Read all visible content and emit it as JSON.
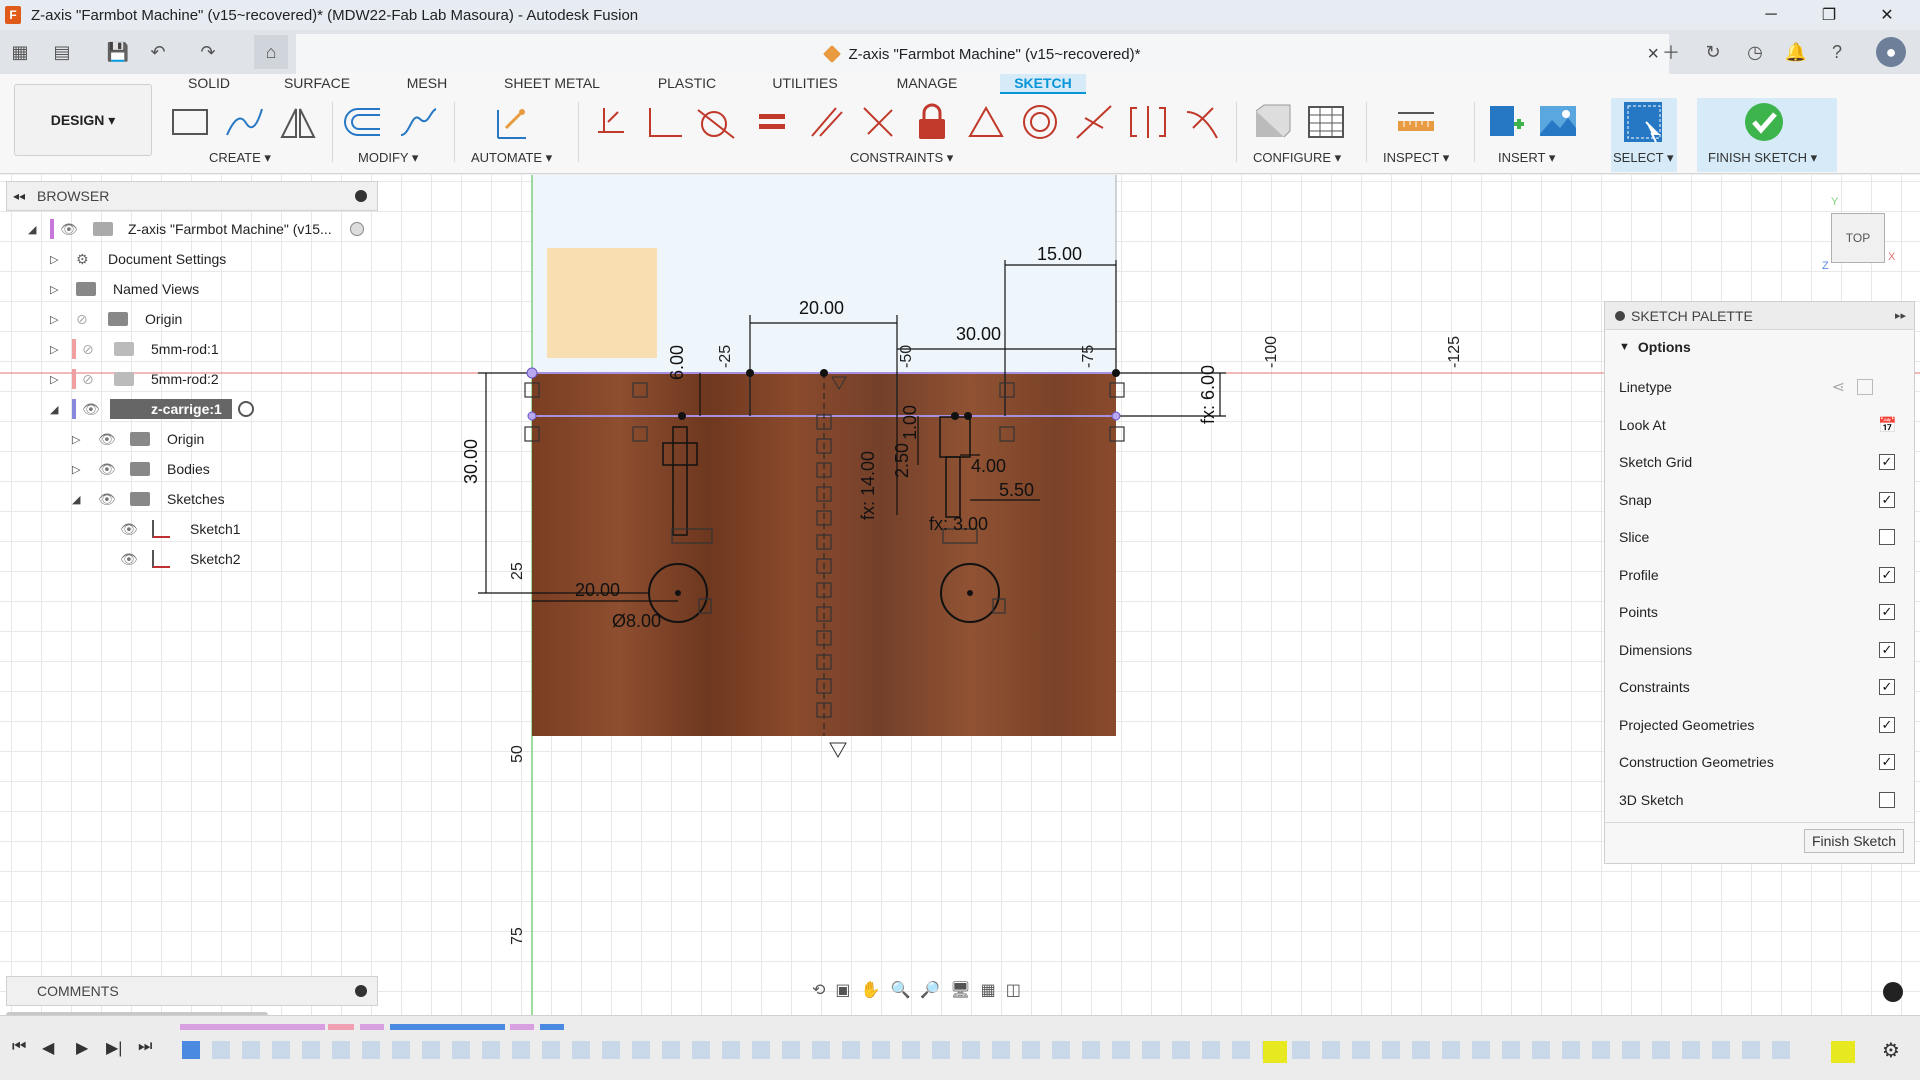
{
  "window": {
    "title": "Z-axis \"Farmbot Machine\" (v15~recovered)* (MDW22-Fab Lab Masoura) - Autodesk Fusion",
    "logo_letter": "F"
  },
  "document_tab": {
    "title": "Z-axis \"Farmbot Machine\" (v15~recovered)*",
    "close": "×"
  },
  "ribbon": {
    "tabs": [
      "SOLID",
      "SURFACE",
      "MESH",
      "SHEET METAL",
      "PLASTIC",
      "UTILITIES",
      "MANAGE",
      "SKETCH"
    ],
    "active_tab": "SKETCH",
    "workspace": "DESIGN ▾",
    "groups": {
      "create": "CREATE ▾",
      "modify": "MODIFY ▾",
      "automate": "AUTOMATE ▾",
      "constraints": "CONSTRAINTS ▾",
      "configure": "CONFIGURE ▾",
      "inspect": "INSPECT ▾",
      "insert": "INSERT ▾",
      "select": "SELECT ▾",
      "finish_sketch": "FINISH SKETCH ▾"
    }
  },
  "browser": {
    "title": "BROWSER",
    "items": [
      {
        "label": "Z-axis \"Farmbot Machine\" (v15..."
      },
      {
        "label": "Document Settings"
      },
      {
        "label": "Named Views"
      },
      {
        "label": "Origin"
      },
      {
        "label": "5mm-rod:1"
      },
      {
        "label": "5mm-rod:2"
      },
      {
        "label": "z-carrige:1"
      },
      {
        "label": "Origin"
      },
      {
        "label": "Bodies"
      },
      {
        "label": "Sketches"
      },
      {
        "label": "Sketch1"
      },
      {
        "label": "Sketch2"
      }
    ]
  },
  "comments": {
    "title": "COMMENTS"
  },
  "sketch_palette": {
    "title": "SKETCH PALETTE",
    "section": "Options",
    "options": [
      {
        "label": "Linetype",
        "checked": null
      },
      {
        "label": "Look At",
        "checked": null
      },
      {
        "label": "Sketch Grid",
        "checked": true
      },
      {
        "label": "Snap",
        "checked": true
      },
      {
        "label": "Slice",
        "checked": false
      },
      {
        "label": "Profile",
        "checked": true
      },
      {
        "label": "Points",
        "checked": true
      },
      {
        "label": "Dimensions",
        "checked": true
      },
      {
        "label": "Constraints",
        "checked": true
      },
      {
        "label": "Projected Geometries",
        "checked": true
      },
      {
        "label": "Construction Geometries",
        "checked": true
      },
      {
        "label": "3D Sketch",
        "checked": false
      }
    ],
    "finish_button": "Finish Sketch"
  },
  "viewcube": {
    "face": "TOP",
    "axis_y": "Y",
    "axis_x": "X",
    "axis_z": "Z"
  },
  "dimensions": {
    "d1": "15.00",
    "d2": "20.00",
    "d3": "30.00",
    "d4": "6.00",
    "d5": "fx: 6.00",
    "d6": "30.00",
    "d7": "fx: 14.00",
    "d8": "2.50",
    "d9": "1.00",
    "d10": "4.00",
    "d11": "5.50",
    "d12": "fx: 3.00",
    "d13": "20.00",
    "d14": "Ø8.00"
  },
  "ruler": {
    "top": [
      "-25",
      "-50",
      "-75",
      "-100",
      "-125"
    ],
    "left": [
      "25",
      "50",
      "75"
    ]
  },
  "colors": {
    "accent": "#0696d7",
    "wood": "#8a4a2c",
    "finish_green": "#3cb44b"
  }
}
